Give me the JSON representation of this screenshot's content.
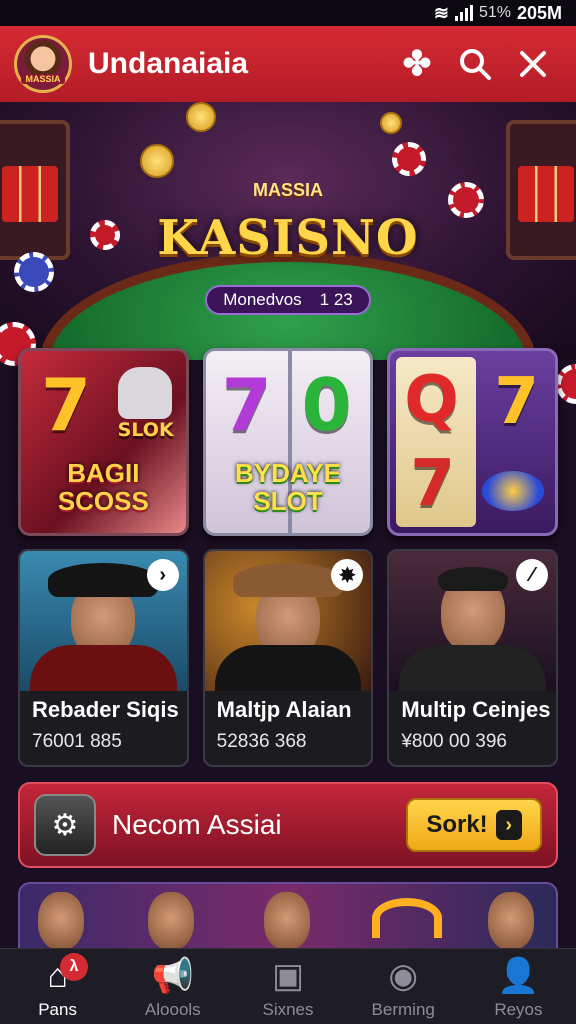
{
  "status_bar": {
    "battery": "51%",
    "time": "205M"
  },
  "app_bar": {
    "title": "Undanaiaia",
    "avatar_label": "MASSIA",
    "icons": [
      "spade-icon",
      "search-icon",
      "close-icon"
    ]
  },
  "hero": {
    "subtitle": "MASSIA",
    "logo": "KASISNO",
    "coins_label": "Monedvos",
    "coins_value": "1 23"
  },
  "slots": [
    {
      "symbols": [
        "7"
      ],
      "badge": "SLOK",
      "label": "BAGII SCOSS"
    },
    {
      "symbols": [
        "7",
        "0"
      ],
      "label": "BYDAYE SLOT"
    },
    {
      "symbols": [
        "Q",
        "7",
        "7"
      ]
    }
  ],
  "cards": [
    {
      "name": "Rebader Siqis",
      "score": "76001 885",
      "badge": "›"
    },
    {
      "name": "Maltjp Alaian",
      "score": "52836 368",
      "badge": "✸"
    },
    {
      "name": "Multip Ceinjes",
      "score": "¥800 00 396",
      "badge": "⁄"
    }
  ],
  "banner": {
    "text": "Necom Assiai",
    "button": "Sork!",
    "button_arrow": "›"
  },
  "nav": [
    {
      "label": "Pans",
      "icon": "home-icon",
      "glyph": "⌂",
      "badge": "λ",
      "active": true
    },
    {
      "label": "Aloools",
      "icon": "megaphone-icon",
      "glyph": "📢",
      "active": false
    },
    {
      "label": "Sixnes",
      "icon": "box-icon",
      "glyph": "▣",
      "active": false
    },
    {
      "label": "Berming",
      "icon": "location-icon",
      "glyph": "◉",
      "active": false
    },
    {
      "label": "Reyos",
      "icon": "user-icon",
      "glyph": "👤",
      "active": false
    }
  ],
  "colors": {
    "primary": "#c8222f",
    "accent": "#ffd54a",
    "background": "#1a0f22"
  }
}
